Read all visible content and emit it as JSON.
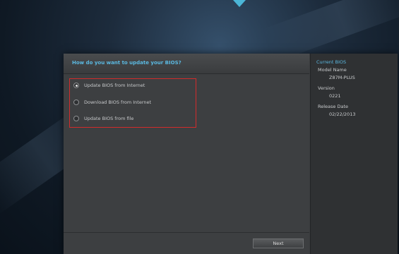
{
  "dialog": {
    "question": "How do you want to update your BIOS?",
    "options": [
      {
        "label": "Update BIOS from Internet",
        "selected": true
      },
      {
        "label": "Download BIOS from Internet",
        "selected": false
      },
      {
        "label": "Update BIOS from file",
        "selected": false
      }
    ],
    "next_label": "Next"
  },
  "current_bios": {
    "title": "Current BIOS",
    "model_name_label": "Model Name",
    "model_name_value": "Z87M-PLUS",
    "version_label": "Version",
    "version_value": "0221",
    "release_date_label": "Release Date",
    "release_date_value": "02/22/2013"
  },
  "colors": {
    "accent": "#5ab8e0",
    "highlight_box": "#d22b2b"
  }
}
